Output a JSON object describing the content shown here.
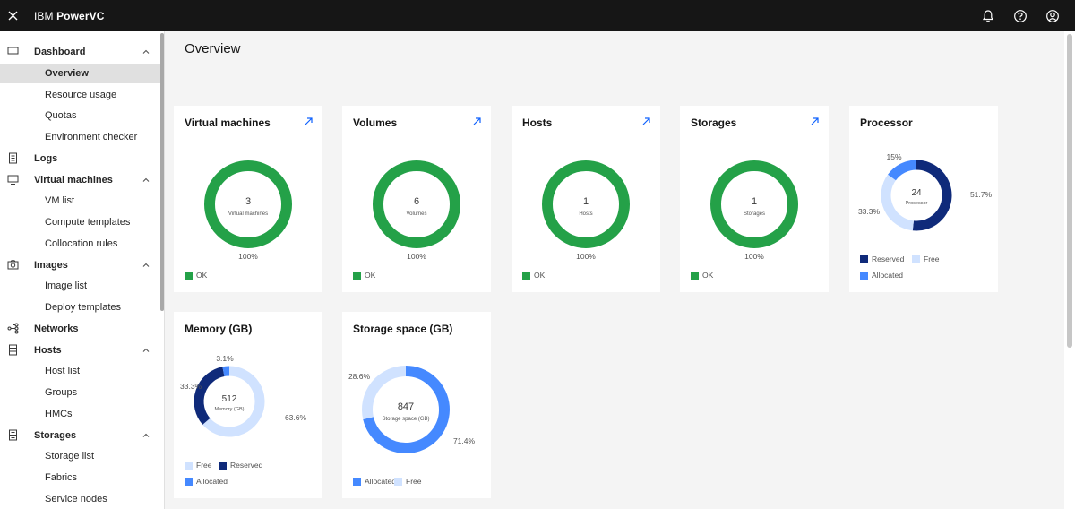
{
  "app": {
    "brand_prefix": "IBM ",
    "brand_name": "PowerVC"
  },
  "page": {
    "title": "Overview"
  },
  "colors": {
    "ok": "#24a148",
    "reserved": "#0f2a7a",
    "free": "#d0e2ff",
    "allocated": "#4589ff",
    "topbar": "#161616"
  },
  "sidebar": {
    "items": [
      {
        "label": "Dashboard",
        "level": "top",
        "icon": "monitor-icon",
        "chevron": "up"
      },
      {
        "label": "Overview",
        "level": "sub",
        "active": true
      },
      {
        "label": "Resource usage",
        "level": "sub"
      },
      {
        "label": "Quotas",
        "level": "sub"
      },
      {
        "label": "Environment checker",
        "level": "sub"
      },
      {
        "label": "Logs",
        "level": "top",
        "icon": "log-icon"
      },
      {
        "label": "Virtual machines",
        "level": "top",
        "icon": "monitor-icon",
        "chevron": "up"
      },
      {
        "label": "VM list",
        "level": "sub"
      },
      {
        "label": "Compute templates",
        "level": "sub"
      },
      {
        "label": "Collocation rules",
        "level": "sub"
      },
      {
        "label": "Images",
        "level": "top",
        "icon": "camera-icon",
        "chevron": "up"
      },
      {
        "label": "Image list",
        "level": "sub"
      },
      {
        "label": "Deploy templates",
        "level": "sub"
      },
      {
        "label": "Networks",
        "level": "top",
        "icon": "network-icon"
      },
      {
        "label": "Hosts",
        "level": "top",
        "icon": "server-icon",
        "chevron": "up"
      },
      {
        "label": "Host list",
        "level": "sub"
      },
      {
        "label": "Groups",
        "level": "sub"
      },
      {
        "label": "HMCs",
        "level": "sub"
      },
      {
        "label": "Storages",
        "level": "top",
        "icon": "storage-icon",
        "chevron": "up"
      },
      {
        "label": "Storage list",
        "level": "sub"
      },
      {
        "label": "Fabrics",
        "level": "sub"
      },
      {
        "label": "Service nodes",
        "level": "sub"
      }
    ]
  },
  "cards": {
    "vms": {
      "title": "Virtual machines",
      "count": "3",
      "sublabel": "Virtual machines",
      "percent": "100%",
      "legend": "OK"
    },
    "volumes": {
      "title": "Volumes",
      "count": "6",
      "sublabel": "Volumes",
      "percent": "100%",
      "legend": "OK"
    },
    "hosts": {
      "title": "Hosts",
      "count": "1",
      "sublabel": "Hosts",
      "percent": "100%",
      "legend": "OK"
    },
    "storages": {
      "title": "Storages",
      "count": "1",
      "sublabel": "Storages",
      "percent": "100%",
      "legend": "OK"
    },
    "processor": {
      "title": "Processor",
      "count": "24",
      "sublabel": "Processor",
      "segments": [
        {
          "name": "Reserved",
          "value": 51.7,
          "label": "51.7%",
          "color": "#0f2a7a"
        },
        {
          "name": "Free",
          "value": 33.3,
          "label": "33.3%",
          "color": "#d0e2ff"
        },
        {
          "name": "Allocated",
          "value": 15.0,
          "label": "15%",
          "color": "#4589ff"
        }
      ],
      "legend": [
        "Reserved",
        "Free",
        "Allocated"
      ]
    },
    "memory": {
      "title": "Memory (GB)",
      "count": "512",
      "sublabel": "Memory (GB)",
      "segments": [
        {
          "name": "Free",
          "value": 63.6,
          "label": "63.6%",
          "color": "#d0e2ff"
        },
        {
          "name": "Reserved",
          "value": 33.3,
          "label": "33.3%",
          "color": "#0f2a7a"
        },
        {
          "name": "Allocated",
          "value": 3.1,
          "label": "3.1%",
          "color": "#4589ff"
        }
      ],
      "legend": [
        "Free",
        "Reserved",
        "Allocated"
      ]
    },
    "storage_space": {
      "title": "Storage space (GB)",
      "count": "847",
      "sublabel": "Storage space (GB)",
      "segments": [
        {
          "name": "Allocated",
          "value": 71.4,
          "label": "71.4%",
          "color": "#4589ff"
        },
        {
          "name": "Free",
          "value": 28.6,
          "label": "28.6%",
          "color": "#d0e2ff"
        }
      ],
      "legend": [
        "Allocated",
        "Free"
      ]
    }
  }
}
